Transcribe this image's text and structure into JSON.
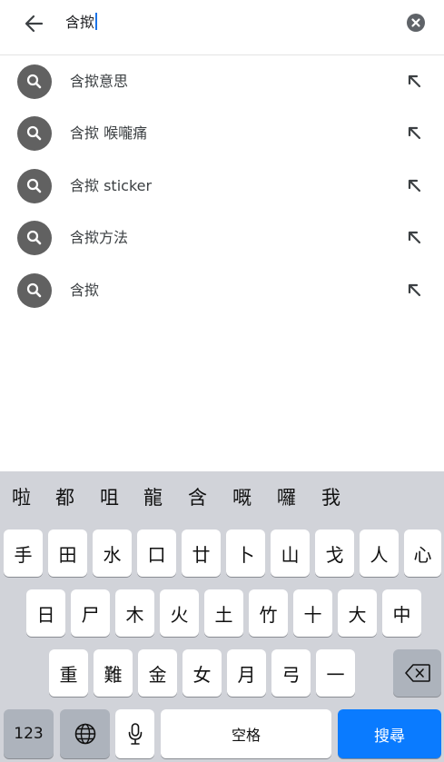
{
  "search": {
    "query": "含揿"
  },
  "suggestions": [
    {
      "text": "含揿意思"
    },
    {
      "text": "含揿 喉嚨痛"
    },
    {
      "text": "含揿 sticker"
    },
    {
      "text": "含揿方法"
    },
    {
      "text": "含揿"
    }
  ],
  "keyboard": {
    "candidates": [
      "啦",
      "都",
      "咀",
      "龍",
      "含",
      "嘅",
      "囉",
      "我"
    ],
    "row1": [
      "手",
      "田",
      "水",
      "口",
      "廿",
      "卜",
      "山",
      "戈",
      "人",
      "心"
    ],
    "row2": [
      "日",
      "尸",
      "木",
      "火",
      "土",
      "竹",
      "十",
      "大",
      "中"
    ],
    "row3": [
      "重",
      "難",
      "金",
      "女",
      "月",
      "弓",
      "一"
    ],
    "numbers_label": "123",
    "space_label": "空格",
    "search_label": "搜尋"
  },
  "colors": {
    "accent": "#0a7bff",
    "suggestion_icon_bg": "#616161",
    "keyboard_bg": "#d1d3d9"
  }
}
